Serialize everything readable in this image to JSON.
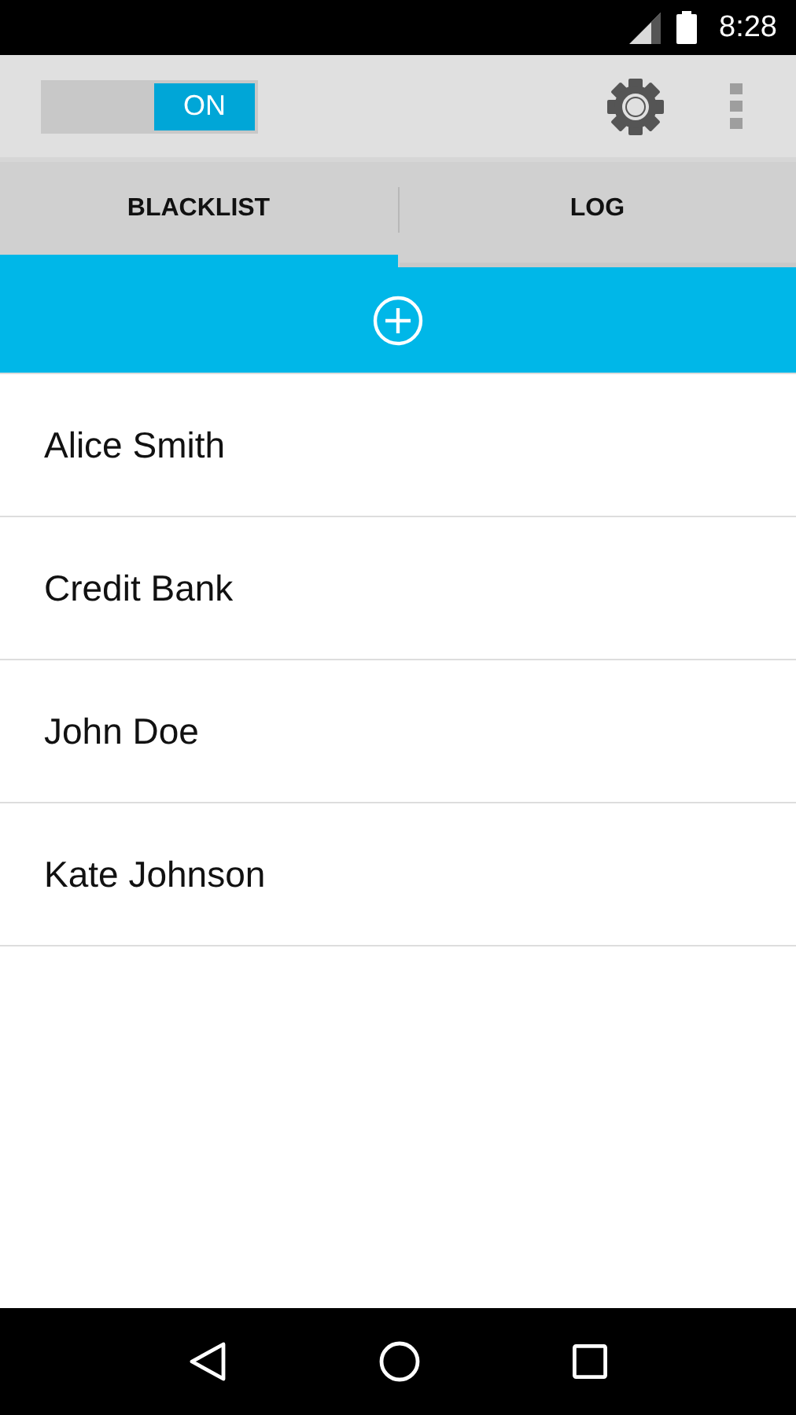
{
  "status_bar": {
    "time": "8:28"
  },
  "toolbar": {
    "toggle": {
      "label": "ON",
      "on": true
    }
  },
  "tabs": [
    {
      "label": "BLACKLIST",
      "selected": true
    },
    {
      "label": "LOG",
      "selected": false
    }
  ],
  "contacts": [
    {
      "name": "Alice Smith"
    },
    {
      "name": "Credit Bank"
    },
    {
      "name": "John Doe"
    },
    {
      "name": "Kate Johnson"
    }
  ]
}
